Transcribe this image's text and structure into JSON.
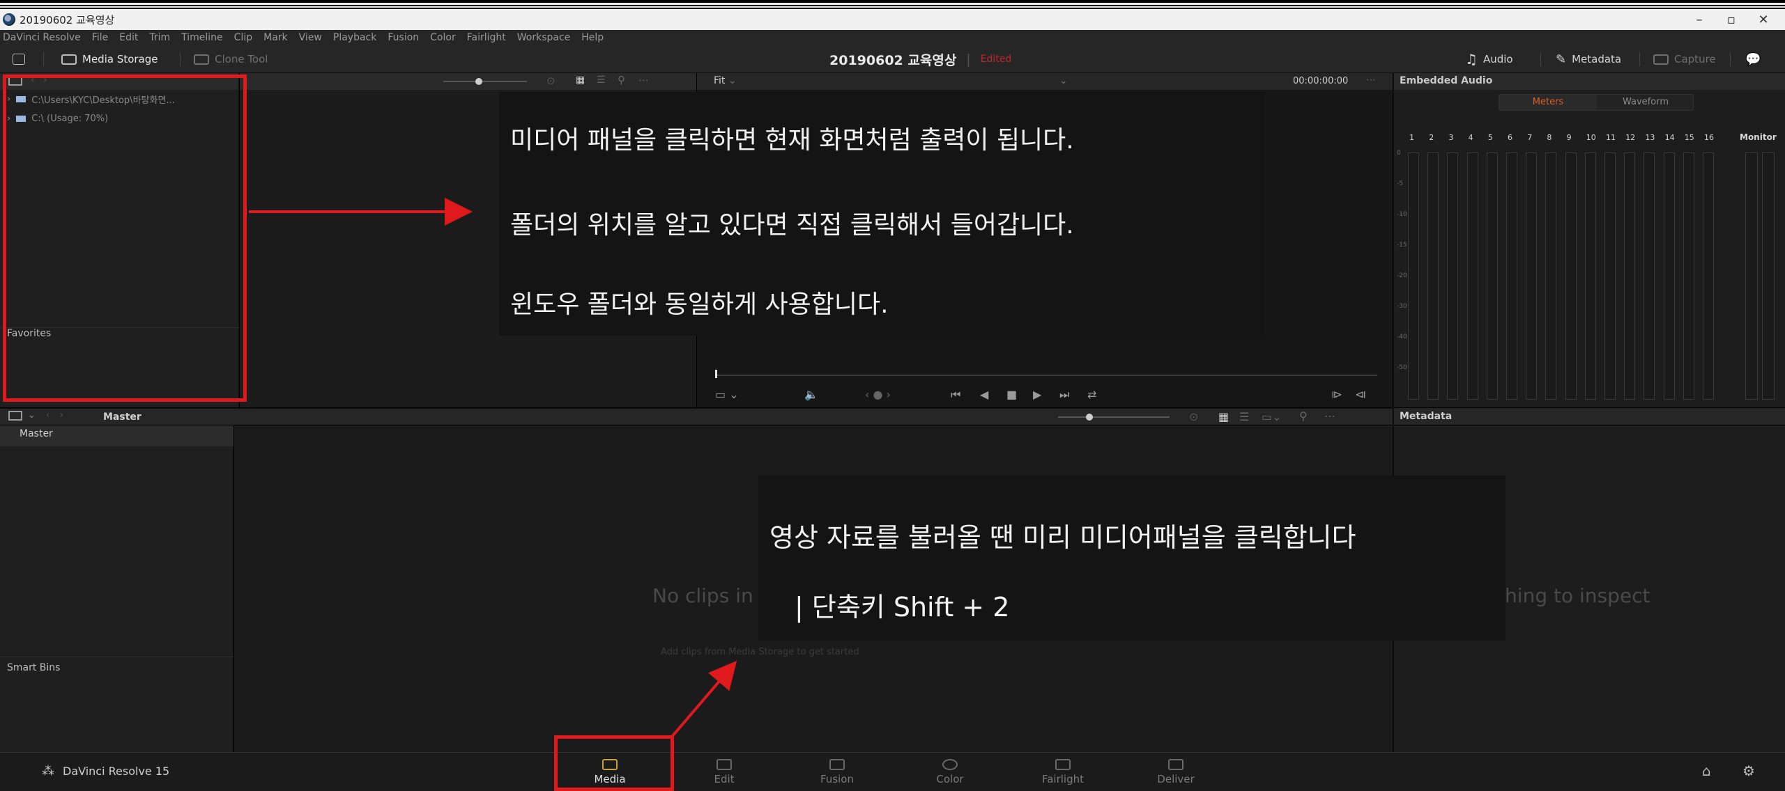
{
  "window": {
    "title": "20190602 교육영상",
    "controls": [
      "–",
      "▫",
      "✕"
    ]
  },
  "menu": [
    "DaVinci Resolve",
    "File",
    "Edit",
    "Trim",
    "Timeline",
    "Clip",
    "Mark",
    "View",
    "Playback",
    "Fusion",
    "Color",
    "Fairlight",
    "Workspace",
    "Help"
  ],
  "toolbar": {
    "media_storage": "Media Storage",
    "clone_tool": "Clone Tool",
    "project_title": "20190602 교육영상",
    "edited_flag": "Edited",
    "audio": "Audio",
    "metadata": "Metadata",
    "capture": "Capture"
  },
  "media_storage": {
    "items": [
      "C:\\Users\\KYC\\Desktop\\바탕화면...",
      "C:\\ (Usage: 70%)"
    ],
    "favorites_label": "Favorites"
  },
  "viewer": {
    "zoom": "Fit",
    "timecode": "00:00:00:00"
  },
  "audio_panel": {
    "title": "Embedded Audio",
    "tab_meters": "Meters",
    "tab_waveform": "Waveform",
    "channels": [
      "1",
      "2",
      "3",
      "4",
      "5",
      "6",
      "7",
      "8",
      "9",
      "10",
      "11",
      "12",
      "13",
      "14",
      "15",
      "16"
    ],
    "monitor_label": "Monitor",
    "db_marks": [
      "0",
      "-5",
      "-10",
      "-15",
      "-20",
      "-30",
      "-40",
      "-50"
    ]
  },
  "media_pool": {
    "header": "Master",
    "bin_master": "Master",
    "smart_bins": "Smart Bins",
    "empty_text": "No clips in media pool",
    "empty_hint": "Add clips from Media Storage to get started"
  },
  "metadata_panel": {
    "title": "Metadata",
    "empty_text": "Nothing to inspect"
  },
  "overlay_top": {
    "line1": "미디어 패널을 클릭하면 현재 화면처럼 출력이 됩니다.",
    "line2": "폴더의 위치를 알고 있다면 직접 클릭해서 들어갑니다.",
    "line3": "윈도우 폴더와 동일하게 사용합니다."
  },
  "overlay_bottom": {
    "line1": "영상 자료를 불러올 땐 미리 미디어패널을 클릭합니다",
    "line2": "|   단축키 Shift + 2"
  },
  "pagebar": {
    "brand": "DaVinci Resolve 15",
    "tabs": [
      "Media",
      "Edit",
      "Fusion",
      "Color",
      "Fairlight",
      "Deliver"
    ]
  },
  "colors": {
    "annotation_red": "#e0191d",
    "edited_red": "#c0282a",
    "meters_orange": "#d6612b"
  }
}
